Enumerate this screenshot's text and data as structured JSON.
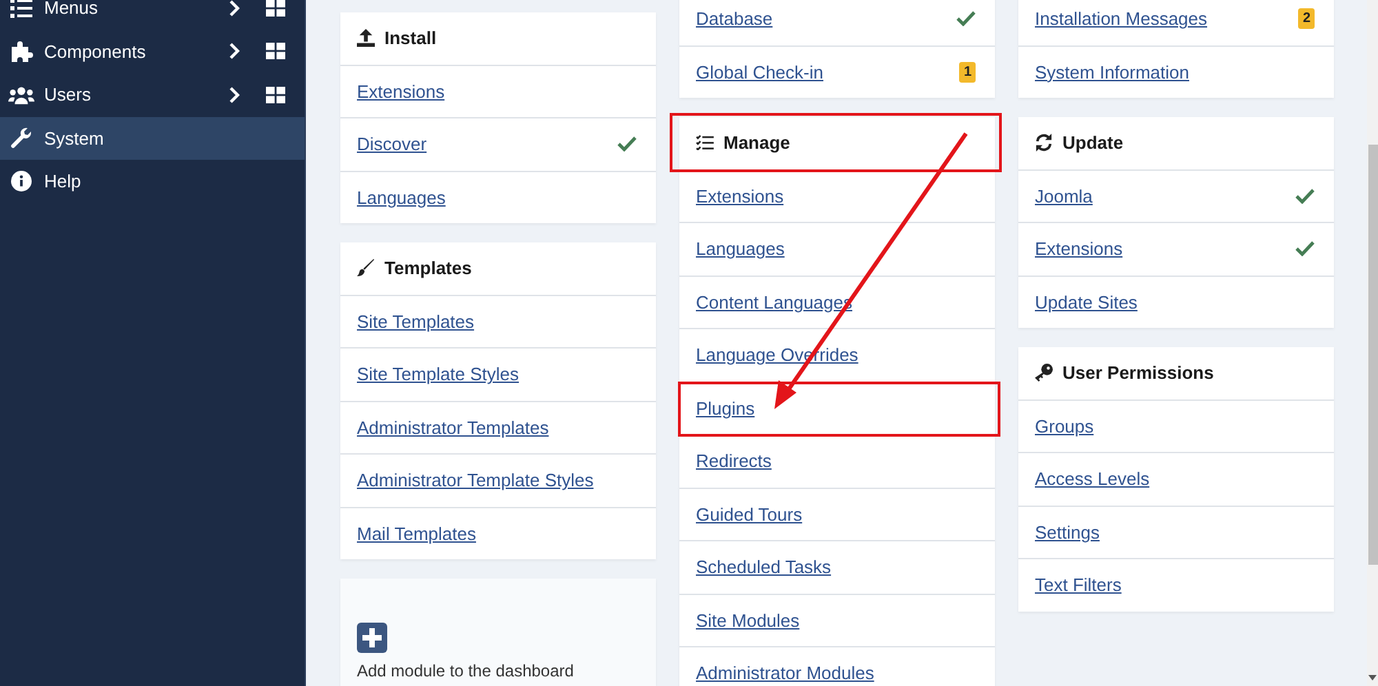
{
  "sidebar": {
    "items": [
      {
        "label": "Menus",
        "submenu": true,
        "dashboard": true,
        "selected": false
      },
      {
        "label": "Components",
        "submenu": true,
        "dashboard": true,
        "selected": false
      },
      {
        "label": "Users",
        "submenu": true,
        "dashboard": true,
        "selected": false
      },
      {
        "label": "System",
        "submenu": false,
        "dashboard": false,
        "selected": true
      },
      {
        "label": "Help",
        "submenu": false,
        "dashboard": false,
        "selected": false
      }
    ]
  },
  "columns": [
    [
      {
        "kind": "links",
        "title": "Install",
        "items": [
          {
            "label": "Extensions",
            "checked": false
          },
          {
            "label": "Discover",
            "checked": true
          },
          {
            "label": "Languages",
            "checked": false
          }
        ]
      },
      {
        "kind": "links",
        "title": "Templates",
        "items": [
          {
            "label": "Site Templates"
          },
          {
            "label": "Site Template Styles"
          },
          {
            "label": "Administrator Templates"
          },
          {
            "label": "Administrator Template Styles"
          },
          {
            "label": "Mail Templates"
          }
        ]
      },
      {
        "kind": "add_module",
        "label": "Add module to the dashboard"
      }
    ],
    [
      {
        "kind": "links",
        "items": [
          {
            "label": "Database",
            "checked": true
          },
          {
            "label": "Global Check-in",
            "checked": false,
            "badge": "1"
          }
        ]
      },
      {
        "kind": "links",
        "title": "Manage",
        "highlighted": true,
        "items": [
          {
            "label": "Extensions",
            "highlighted": false
          },
          {
            "label": "Languages",
            "highlighted": false
          },
          {
            "label": "Content Languages",
            "highlighted": false
          },
          {
            "label": "Language Overrides",
            "highlighted": false
          },
          {
            "label": "Plugins",
            "highlighted": true
          },
          {
            "label": "Redirects",
            "highlighted": false
          },
          {
            "label": "Guided Tours",
            "highlighted": false
          },
          {
            "label": "Scheduled Tasks",
            "highlighted": false
          },
          {
            "label": "Site Modules",
            "highlighted": false
          },
          {
            "label": "Administrator Modules",
            "highlighted": false
          }
        ]
      }
    ],
    [
      {
        "kind": "links",
        "items": [
          {
            "label": "Installation Messages",
            "badge": "2"
          },
          {
            "label": "System Information"
          }
        ]
      },
      {
        "kind": "links",
        "title": "Update",
        "items": [
          {
            "label": "Joomla",
            "checked": true
          },
          {
            "label": "Extensions",
            "checked": true
          },
          {
            "label": "Update Sites",
            "checked": false
          }
        ]
      },
      {
        "kind": "links",
        "title": "User Permissions",
        "items": [
          {
            "label": "Groups"
          },
          {
            "label": "Access Levels"
          },
          {
            "label": "Settings"
          },
          {
            "label": "Text Filters"
          }
        ]
      }
    ]
  ],
  "callout_arrow": true
}
